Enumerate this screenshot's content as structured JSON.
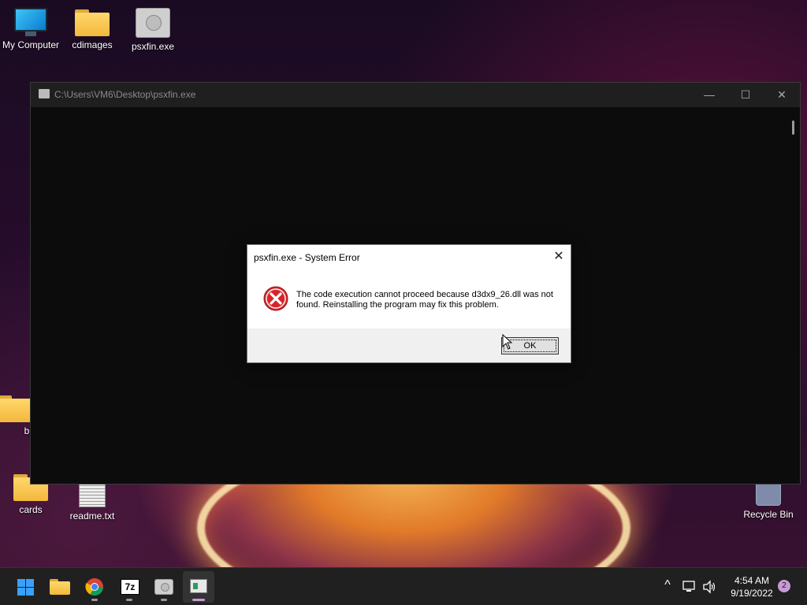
{
  "desktop": {
    "icons": [
      {
        "label": "My Computer"
      },
      {
        "label": "cdimages"
      },
      {
        "label": "psxfin.exe"
      },
      {
        "label": "bi"
      },
      {
        "label": "cards"
      },
      {
        "label": "readme.txt"
      },
      {
        "label": "Recycle Bin"
      }
    ]
  },
  "console": {
    "title": "C:\\Users\\VM6\\Desktop\\psxfin.exe",
    "minimize": "—",
    "maximize": "☐",
    "close": "✕"
  },
  "dialog": {
    "title": "psxfin.exe - System Error",
    "close": "✕",
    "message": "The code execution cannot proceed because d3dx9_26.dll was not found. Reinstalling the program may fix this problem.",
    "ok_label": "OK"
  },
  "taskbar": {
    "apps": [
      "start-icon",
      "file-explorer-icon",
      "chrome-icon",
      "7zip-icon",
      "psx-icon",
      "console-icon"
    ],
    "sevenzip_label": "7z",
    "tray": {
      "chevron": "^",
      "time": "4:54 AM",
      "date": "9/19/2022",
      "notifications": "2"
    }
  },
  "colors": {
    "taskbar": "#202020",
    "accent": "#c79ad6",
    "error_red": "#d6262b"
  }
}
